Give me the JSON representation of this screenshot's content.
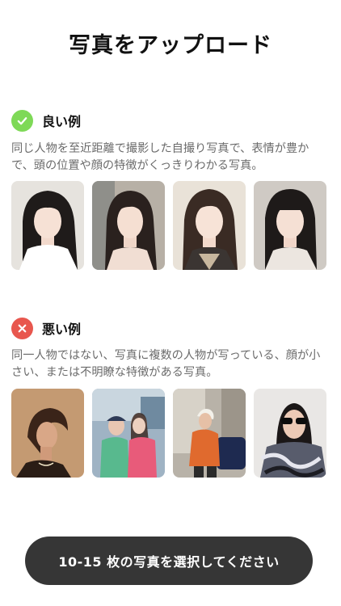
{
  "page": {
    "title": "写真をアップロード"
  },
  "good": {
    "label": "良い例",
    "badge_color": "#7ed957",
    "badge_icon": "check-icon",
    "description": "同じ人物を至近距離で撮影した自撮り写真で、表情が豊かで、頭の位置や顔の特徴がくっきりわかる写真。",
    "photos": [
      "good-photo-1",
      "good-photo-2",
      "good-photo-3",
      "good-photo-4"
    ]
  },
  "bad": {
    "label": "悪い例",
    "badge_color": "#e8574e",
    "badge_icon": "x-icon",
    "description": "同一人物ではない、写真に複数の人物が写っている、顔が小さい、または不明瞭な特徴がある写真。",
    "photos": [
      "bad-photo-1",
      "bad-photo-2",
      "bad-photo-3",
      "bad-photo-4"
    ]
  },
  "cta": {
    "label": "10-15 枚の写真を選択してください",
    "background": "#363636"
  }
}
